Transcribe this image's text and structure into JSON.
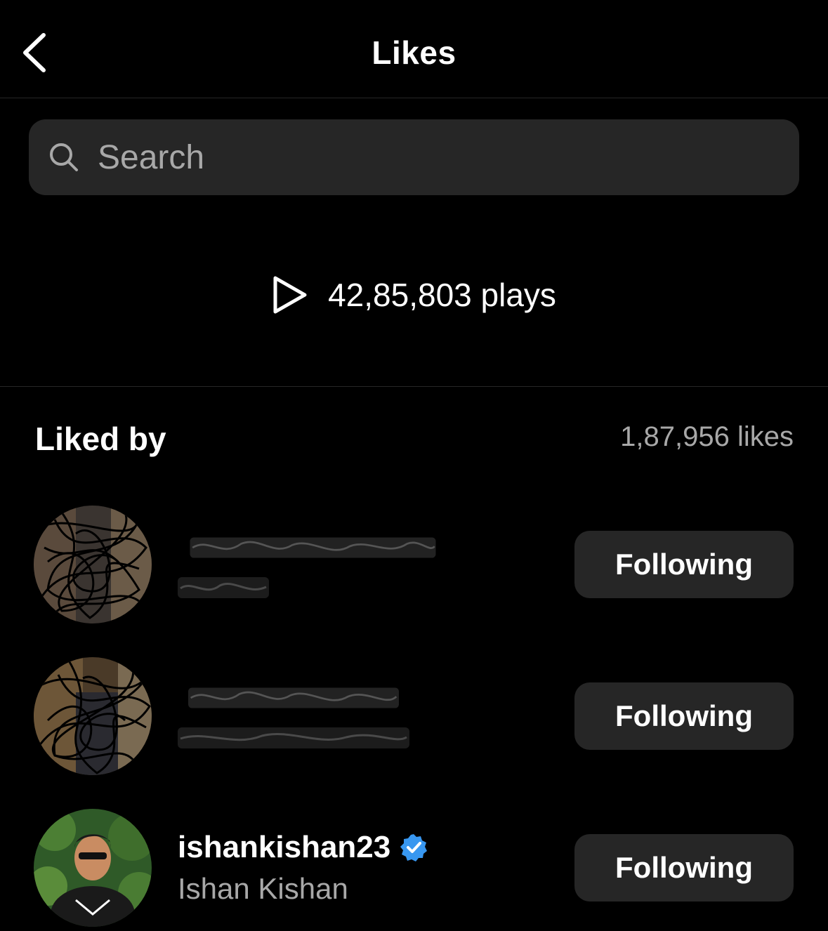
{
  "header": {
    "title": "Likes",
    "back_icon": "chevron-left-icon"
  },
  "search": {
    "placeholder": "Search",
    "value": "",
    "icon": "search-icon"
  },
  "stats": {
    "plays_label": "42,85,803 plays",
    "play_icon": "play-icon"
  },
  "likers": {
    "heading": "Liked by",
    "count_label": "1,87,956 likes",
    "items": [
      {
        "username": "",
        "full_name": "",
        "redacted": true,
        "button_label": "Following"
      },
      {
        "username": "",
        "full_name": "",
        "redacted": true,
        "button_label": "Following"
      },
      {
        "username": "ishankishan23",
        "full_name": "Ishan Kishan",
        "verified": true,
        "button_label": "Following"
      }
    ]
  },
  "colors": {
    "background": "#000000",
    "surface": "#262626",
    "secondary_text": "#a8a8a8",
    "verified_blue": "#3897f0"
  }
}
